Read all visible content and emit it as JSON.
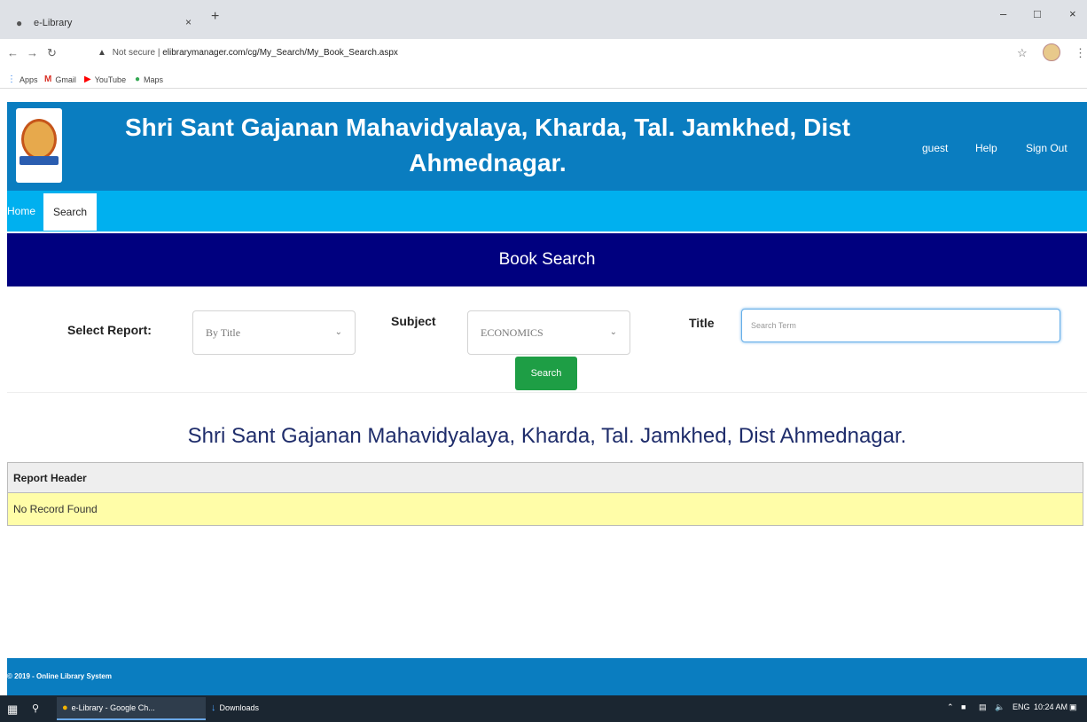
{
  "browser": {
    "tab_title": "e-Library",
    "tab_close": "×",
    "new_tab": "+",
    "url_warning": "Not secure",
    "url_separator": "|",
    "url": "elibrarymanager.com/cg/My_Search/My_Book_Search.aspx",
    "bookmarks": [
      {
        "icon": "apps-icon",
        "label": "Apps"
      },
      {
        "icon": "gmail-icon",
        "label": "Gmail"
      },
      {
        "icon": "youtube-icon",
        "label": "YouTube"
      },
      {
        "icon": "maps-icon",
        "label": "Maps"
      }
    ]
  },
  "site": {
    "title_line1": "Shri Sant Gajanan Mahavidyalaya, Kharda, Tal. Jamkhed, Dist",
    "title_line2": "Ahmednagar.",
    "user": "guest",
    "help": "Help",
    "signout": "Sign Out",
    "header_color": "#0a7dc0",
    "menubar_color": "#00b0ef",
    "titlebar_color": "#00007f"
  },
  "menu": {
    "home": "Home",
    "search": "Search"
  },
  "page": {
    "heading": "Book Search"
  },
  "form": {
    "select_report_label": "Select Report:",
    "select_report_value": "By Title",
    "subject_label": "Subject",
    "subject_value": "ECONOMICS",
    "title_label": "Title",
    "title_placeholder": "Search Term",
    "title_value": "",
    "search_button": "Search",
    "button_color": "#1e9e45"
  },
  "report": {
    "title": "Shri Sant Gajanan Mahavidyalaya, Kharda, Tal. Jamkhed, Dist Ahmednagar.",
    "header": "Report Header",
    "message": "No Record Found",
    "row_color": "#fffda8"
  },
  "footer": {
    "text": "© 2019 - Online Library System"
  },
  "taskbar": {
    "chrome_task": "e-Library - Google Ch...",
    "downloads_task": "Downloads",
    "language": "ENG",
    "time": "10:24 AM"
  }
}
